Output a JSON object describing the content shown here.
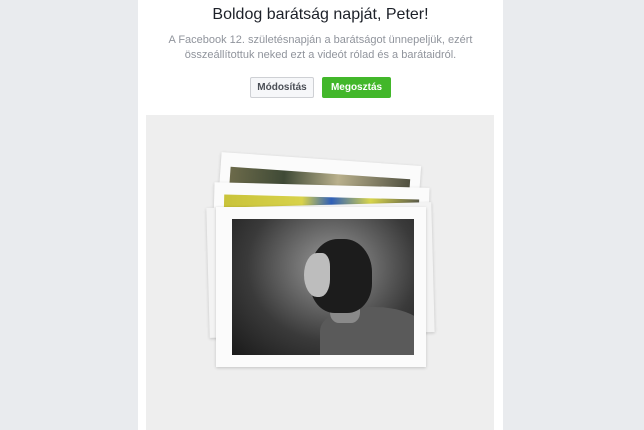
{
  "header": {
    "title": "Boldog barátság napját, Peter!",
    "subtitle_line1": "A Facebook 12. születésnapján a barátságot ünnepeljük, ezért",
    "subtitle_line2": "összeállítottuk neked ezt a videót rólad és a barátaidról."
  },
  "actions": {
    "edit_label": "Módosítás",
    "share_label": "Megosztás"
  },
  "colors": {
    "share_button": "#42b72a",
    "page_background": "#e9ebee"
  }
}
